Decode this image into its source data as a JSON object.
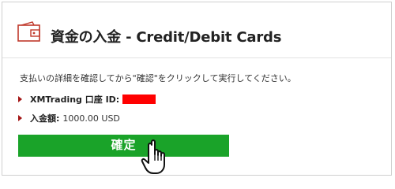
{
  "header": {
    "title": "資金の入金 - Credit/Debit Cards",
    "icon": "wallet-icon"
  },
  "instruction": "支払いの詳細を確認してから\"確認\"をクリックして実行してください。",
  "details": {
    "account": {
      "label": "XMTrading 口座 ID:",
      "value_redacted": true
    },
    "amount": {
      "label": "入金額:",
      "value": "1000.00 USD"
    }
  },
  "confirm": {
    "label": "確定",
    "cursor_icon": "hand-pointer-icon"
  },
  "colors": {
    "accent_red": "#a31515",
    "icon_red": "#c0392b",
    "button_green": "#1aa329",
    "redaction": "#ff0000"
  }
}
